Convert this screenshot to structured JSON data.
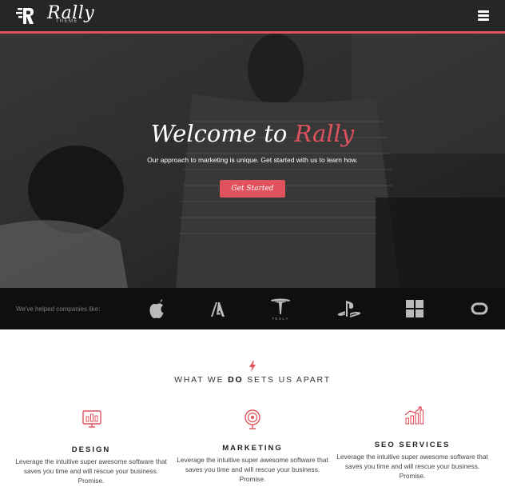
{
  "header": {
    "brand_name": "Rally",
    "brand_sub": "THEME",
    "logo_icon": "rally-r-icon",
    "menu_icon": "hamburger-menu-icon"
  },
  "hero": {
    "title_part1": "Welcome to ",
    "title_accent": "Rally",
    "subtitle": "Our approach to marketing is unique. Get started with us to learn how.",
    "cta_label": "Get Started",
    "accent_color": "#e0525d"
  },
  "clients": {
    "label": "We've helped companies like:",
    "logos": [
      "apple-icon",
      "adobe-icon",
      "tesla-icon",
      "playstation-icon",
      "windows-icon",
      "oculus-icon"
    ],
    "tesla_wordmark": "TESLA"
  },
  "features": {
    "section_icon": "lightning-bolt-icon",
    "heading_part1": "WHAT WE ",
    "heading_bold": "DO",
    "heading_part2": " SETS US APART",
    "items": [
      {
        "icon": "monitor-chart-icon",
        "title": "DESIGN",
        "text": "Leverage the intuitive super awesome software that saves you time and will rescue your business. Promise."
      },
      {
        "icon": "target-icon",
        "title": "MARKETING",
        "text": "Leverage the intuitive super awesome software that saves you time and will rescue your business. Promise."
      },
      {
        "icon": "growth-chart-icon",
        "title": "SEO SERVICES",
        "text": "Leverage the intuitive super awesome software that saves you time and will rescue your business. Promise."
      }
    ]
  }
}
